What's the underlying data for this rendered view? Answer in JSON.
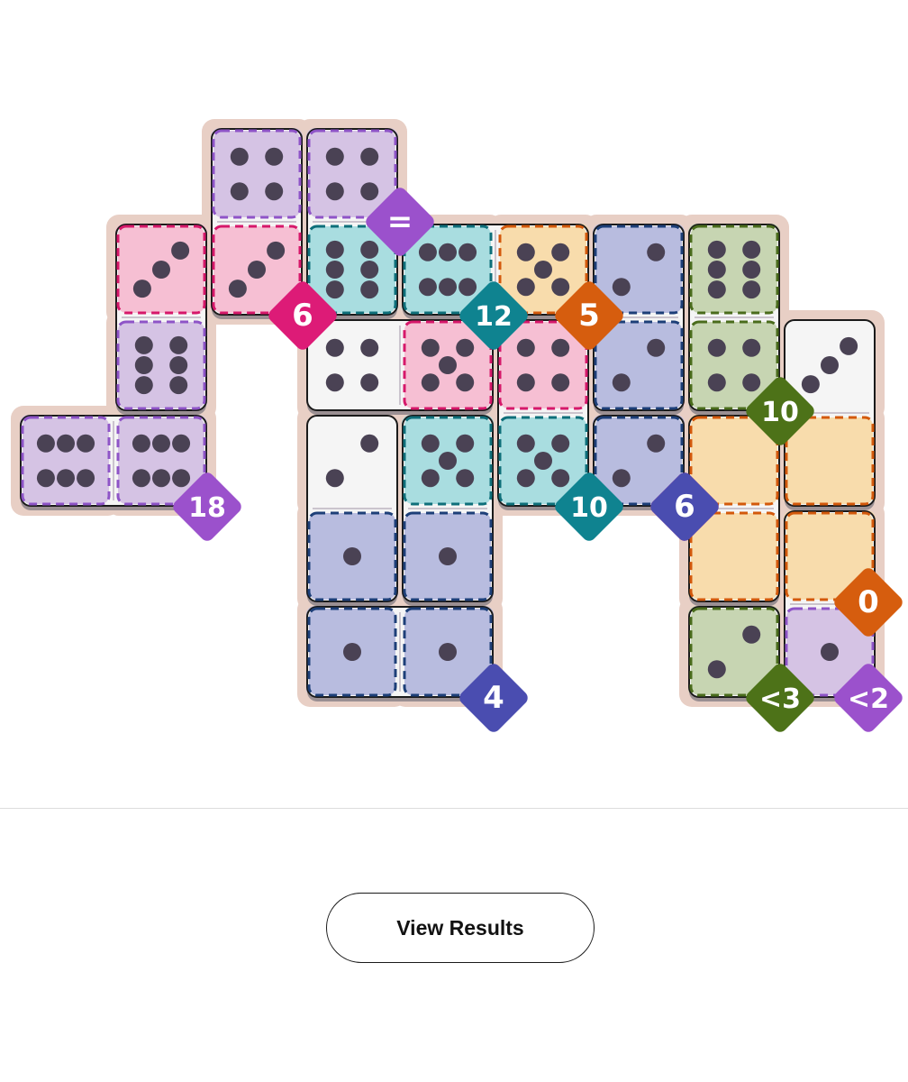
{
  "game": {
    "colors": {
      "purple": {
        "fill": "#d5c3e4",
        "border": "#8e54c7",
        "badge": "#9b51cc"
      },
      "pink": {
        "fill": "#f6bfd3",
        "border": "#d6186a",
        "badge": "#dd1b77"
      },
      "teal": {
        "fill": "#a9dde0",
        "border": "#0e6f7a",
        "badge": "#0f8390"
      },
      "orange": {
        "fill": "#f8dcac",
        "border": "#d3590c",
        "badge": "#d65d0e"
      },
      "navy": {
        "fill": "#b8bcdf",
        "border": "#1d3f78",
        "badge": "#4a4db0"
      },
      "green": {
        "fill": "#c7d5b2",
        "border": "#4a6c1c",
        "badge": "#4d7218"
      },
      "plain": {
        "fill": "#f5f5f5",
        "border": "#000000",
        "badge": "#000000"
      },
      "pip": "#4a4254",
      "board": "#e8cfc5"
    },
    "regions": [
      {
        "color": "purple",
        "cells": [
          [
            2,
            0
          ],
          [
            3,
            0
          ]
        ],
        "label": "="
      },
      {
        "color": "pink",
        "cells": [
          [
            1,
            1
          ],
          [
            2,
            1
          ]
        ],
        "label": "6"
      },
      {
        "color": "purple",
        "cells": [
          [
            1,
            2
          ],
          [
            0,
            3
          ],
          [
            1,
            3
          ]
        ],
        "label": "18"
      },
      {
        "color": "teal",
        "cells": [
          [
            3,
            1
          ],
          [
            4,
            1
          ]
        ],
        "label": "12"
      },
      {
        "color": "orange",
        "cells": [
          [
            5,
            1
          ]
        ],
        "label": "5"
      },
      {
        "color": "navy",
        "cells": [
          [
            6,
            1
          ]
        ],
        "label": ""
      },
      {
        "color": "green",
        "cells": [
          [
            7,
            1
          ],
          [
            7,
            2
          ]
        ],
        "label": "10"
      },
      {
        "color": "pink",
        "cells": [
          [
            4,
            2
          ],
          [
            5,
            2
          ],
          [
            6,
            2
          ],
          [
            6,
            3
          ]
        ],
        "label": "≠"
      },
      {
        "color": "teal",
        "cells": [
          [
            4,
            3
          ],
          [
            5,
            3
          ]
        ],
        "label": "10"
      },
      {
        "color": "navy",
        "cells": [
          [
            6,
            3
          ]
        ],
        "label": "6"
      },
      {
        "color": "orange",
        "cells": [
          [
            7,
            3
          ],
          [
            8,
            3
          ],
          [
            7,
            4
          ],
          [
            8,
            4
          ]
        ],
        "label": "0"
      },
      {
        "color": "navy",
        "cells": [
          [
            3,
            4
          ],
          [
            4,
            4
          ],
          [
            3,
            5
          ],
          [
            4,
            5
          ]
        ],
        "label": "4"
      },
      {
        "color": "green",
        "cells": [
          [
            7,
            5
          ]
        ],
        "label": "<3"
      },
      {
        "color": "purple",
        "cells": [
          [
            8,
            5
          ]
        ],
        "label": "<2"
      }
    ],
    "dominoes": [
      {
        "a": [
          2,
          0
        ],
        "b": [
          2,
          1
        ],
        "pa": 4,
        "pb": 3,
        "ca": "purple",
        "cb": "pink"
      },
      {
        "a": [
          3,
          0
        ],
        "b": [
          3,
          1
        ],
        "pa": 4,
        "pb": 6,
        "ca": "purple",
        "cb": "teal"
      },
      {
        "a": [
          1,
          1
        ],
        "b": [
          1,
          2
        ],
        "pa": 3,
        "pb": 6,
        "ca": "pink",
        "cb": "purple"
      },
      {
        "a": [
          0,
          3
        ],
        "b": [
          1,
          3
        ],
        "pa": 6,
        "pb": 6,
        "ca": "purple",
        "cb": "purple"
      },
      {
        "a": [
          4,
          1
        ],
        "b": [
          5,
          1
        ],
        "pa": 6,
        "pb": 5,
        "ca": "teal",
        "cb": "orange"
      },
      {
        "a": [
          6,
          1
        ],
        "b": [
          6,
          2
        ],
        "pa": 2,
        "pb": 2,
        "ca": "navy",
        "cb": "navy"
      },
      {
        "a": [
          7,
          1
        ],
        "b": [
          7,
          2
        ],
        "pa": 6,
        "pb": 4,
        "ca": "green",
        "cb": "green"
      },
      {
        "a": [
          3,
          2
        ],
        "b": [
          4,
          2
        ],
        "pa": 4,
        "pb": 5,
        "ca": "plain",
        "cb": "pink"
      },
      {
        "a": [
          5,
          2
        ],
        "b": [
          5,
          3
        ],
        "pa": 4,
        "pb": 5,
        "ca": "pink",
        "cb": "teal"
      },
      {
        "a": [
          8,
          2
        ],
        "b": [
          8,
          3
        ],
        "pa": 3,
        "pb": 0,
        "ca": "plain",
        "cb": "orange"
      },
      {
        "a": [
          3,
          3
        ],
        "b": [
          3,
          4
        ],
        "pa": 2,
        "pb": 1,
        "ca": "plain",
        "cb": "navy"
      },
      {
        "a": [
          4,
          3
        ],
        "b": [
          4,
          4
        ],
        "pa": 5,
        "pb": 1,
        "ca": "teal",
        "cb": "navy"
      },
      {
        "a": [
          6,
          3
        ],
        "b": [
          6,
          3
        ],
        "pa": 2,
        "pb": 2,
        "ca": "navy",
        "cb": "navy",
        "single": true
      },
      {
        "a": [
          7,
          3
        ],
        "b": [
          7,
          4
        ],
        "pa": 0,
        "pb": 0,
        "ca": "orange",
        "cb": "orange"
      },
      {
        "a": [
          8,
          4
        ],
        "b": [
          8,
          5
        ],
        "pa": 0,
        "pb": 1,
        "ca": "orange",
        "cb": "purple"
      },
      {
        "a": [
          3,
          5
        ],
        "b": [
          4,
          5
        ],
        "pa": 1,
        "pb": 1,
        "ca": "navy",
        "cb": "navy"
      },
      {
        "a": [
          7,
          5
        ],
        "b": [
          7,
          5
        ],
        "pa": 2,
        "pb": 2,
        "ca": "green",
        "cb": "green",
        "single": true
      }
    ]
  },
  "actions": {
    "view_results": "View Results"
  }
}
